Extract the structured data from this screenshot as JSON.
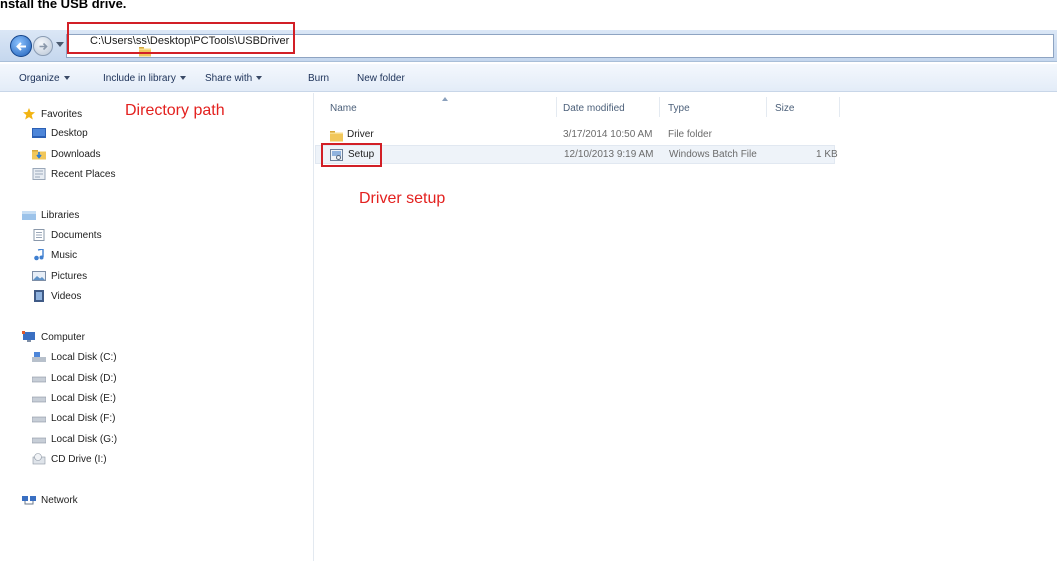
{
  "page_heading": "nstall the USB drive.",
  "address": {
    "path": "C:\\Users\\ss\\Desktop\\PCTools\\USBDriver"
  },
  "toolbar": {
    "organize": "Organize",
    "include_in_library": "Include in library",
    "share_with": "Share with",
    "burn": "Burn",
    "new_folder": "New folder"
  },
  "nav": {
    "favorites": "Favorites",
    "desktop": "Desktop",
    "downloads": "Downloads",
    "recent_places": "Recent Places",
    "libraries": "Libraries",
    "documents": "Documents",
    "music": "Music",
    "pictures": "Pictures",
    "videos": "Videos",
    "computer": "Computer",
    "disk_c": "Local Disk (C:)",
    "disk_d": "Local Disk (D:)",
    "disk_e": "Local Disk (E:)",
    "disk_f": "Local Disk (F:)",
    "disk_g": "Local Disk (G:)",
    "cd_drive": "CD Drive (I:)",
    "network": "Network"
  },
  "annotations": {
    "directory_path": "Directory path",
    "driver_setup": "Driver setup",
    "highlight_color": "#d21f26"
  },
  "columns": {
    "name": "Name",
    "date_modified": "Date modified",
    "type": "Type",
    "size": "Size"
  },
  "files": [
    {
      "name": "Driver",
      "date": "3/17/2014 10:50 AM",
      "type": "File folder",
      "size": "",
      "icon": "folder-icon"
    },
    {
      "name": "Setup",
      "date": "12/10/2013 9:19 AM",
      "type": "Windows Batch File",
      "size": "1 KB",
      "icon": "batch-file-icon"
    }
  ]
}
